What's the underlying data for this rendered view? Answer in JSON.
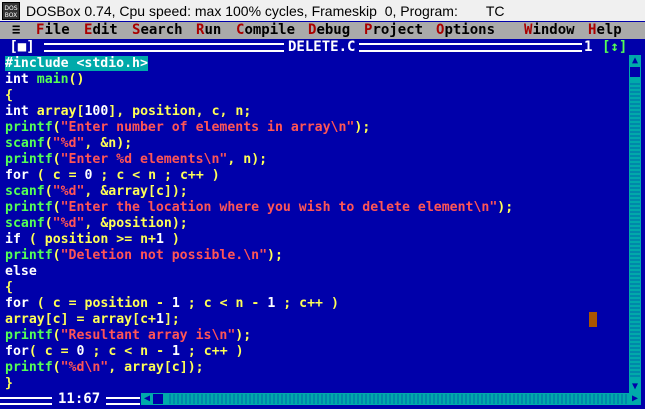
{
  "window": {
    "icon_text": "DOS BOX",
    "title": "DOSBox 0.74, Cpu speed: max 100% cycles, Frameskip  0, Program:",
    "program": "TC"
  },
  "menu": {
    "system": "≡",
    "items": [
      {
        "hot": "F",
        "rest": "ile"
      },
      {
        "hot": "E",
        "rest": "dit"
      },
      {
        "hot": "S",
        "rest": "earch"
      },
      {
        "hot": "R",
        "rest": "un"
      },
      {
        "hot": "C",
        "rest": "ompile"
      },
      {
        "hot": "D",
        "rest": "ebug"
      },
      {
        "hot": "P",
        "rest": "roject"
      },
      {
        "hot": "O",
        "rest": "ptions"
      },
      {
        "hot": "W",
        "rest": "indow"
      },
      {
        "hot": "H",
        "rest": "elp"
      }
    ]
  },
  "editor": {
    "close_box": "[■]",
    "filename": "DELETE.C",
    "window_number": "1",
    "zoom_box": "[↕]",
    "status_position": "11:67",
    "code_lines": [
      "#include <stdio.h>",
      "int main()",
      "{",
      "int array[100], position, c, n;",
      "printf(\"Enter number of elements in array\\n\");",
      "scanf(\"%d\", &n);",
      "printf(\"Enter %d elements\\n\", n);",
      "for ( c = 0 ; c < n ; c++ )",
      "scanf(\"%d\", &array[c]);",
      "printf(\"Enter the location where you wish to delete element\\n\");",
      "scanf(\"%d\", &position);",
      "if ( position >= n+1 )",
      "printf(\"Deletion not possible.\\n\");",
      "else",
      "{",
      "for ( c = position - 1 ; c < n - 1 ; c++ )",
      "array[c] = array[c+1];",
      "printf(\"Resultant array is\\n\");",
      "for( c = 0 ; c < n - 1 ; c++ )",
      "printf(\"%d\\n\", array[c]);",
      "}"
    ]
  },
  "colors": {
    "background": "#0000AA",
    "code_text": "#FFFF55",
    "keyword": "#FFFFFF",
    "function": "#55FF55",
    "string": "#FF5555",
    "preprocessor_highlight": "#00AAAA",
    "menu_bg": "#AAAAAA",
    "menu_hotkey": "#AA0000",
    "cursor": "#AA5500"
  }
}
